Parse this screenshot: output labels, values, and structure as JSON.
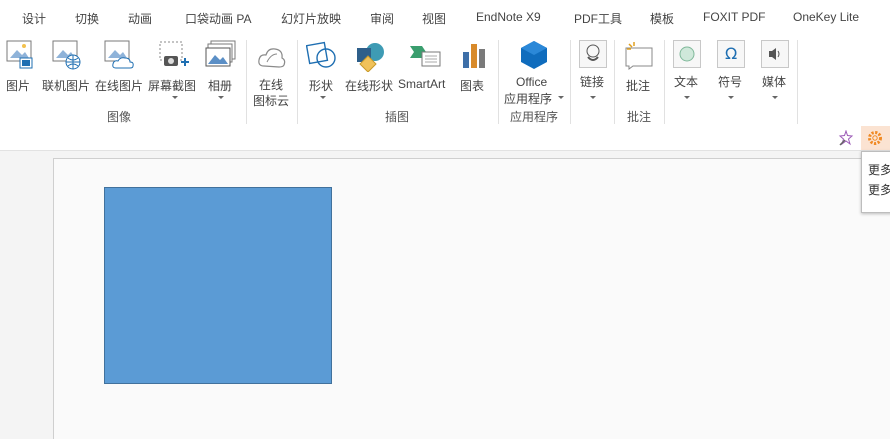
{
  "tabs": [
    "设计",
    "切换",
    "动画",
    "口袋动画 PA",
    "幻灯片放映",
    "审阅",
    "视图",
    "EndNote X9",
    "PDF工具",
    "模板",
    "FOXIT PDF",
    "OneKey Lite"
  ],
  "ribbon": {
    "picture": "图片",
    "online_picture_linked": "联机图片",
    "online_picture": "在线图片",
    "screenshot": "屏幕截图",
    "album": "相册",
    "cloud_line1": "在线",
    "cloud_line2": "图标云",
    "shapes": "形状",
    "online_shapes": "在线形状",
    "smartart": "SmartArt",
    "chart": "图表",
    "office_line1": "Office",
    "office_line2": "应用程序",
    "link": "链接",
    "comment": "批注",
    "text": "文本",
    "symbol": "符号",
    "media": "媒体"
  },
  "groups": {
    "images": "图像",
    "illustrations": "插图",
    "apps": "应用程序",
    "comments": "批注"
  },
  "tooltip": {
    "line1": "更多",
    "line2": "更多"
  },
  "colors": {
    "shape_fill": "#5b9bd5",
    "shape_border": "#41719c",
    "office_blue": "#0f6cbd",
    "accent_orange": "#f08a24"
  }
}
